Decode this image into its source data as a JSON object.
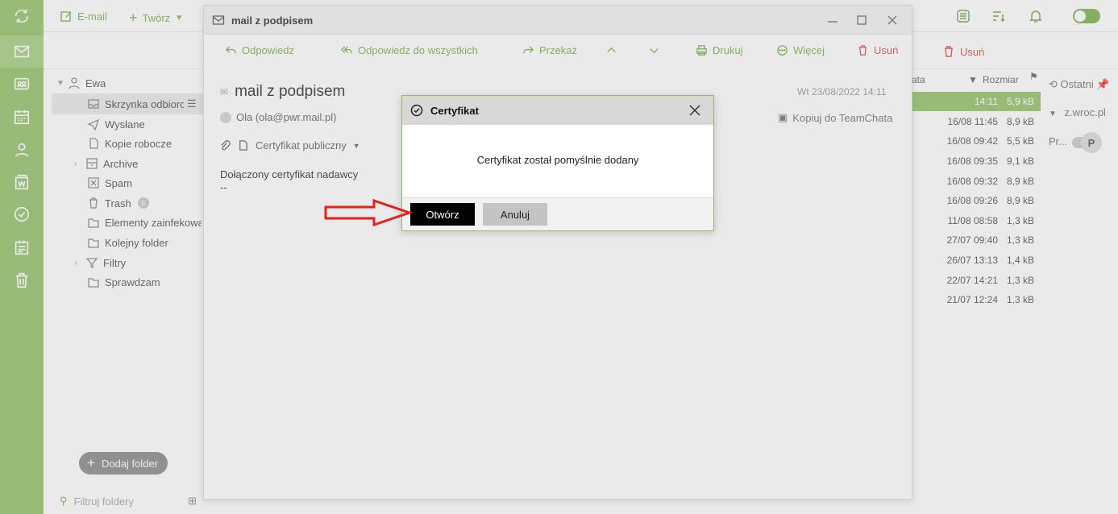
{
  "colors": {
    "accent": "#7db351",
    "rail": "#96c56e",
    "danger": "#d9534f",
    "dialog_border": "#8fbf66"
  },
  "rail": {
    "icons": [
      "sync-icon",
      "mail-icon",
      "contacts-chat-icon",
      "calendar-icon",
      "person-icon",
      "word-icon",
      "check-circle-icon",
      "tasks-icon",
      "trash-icon"
    ]
  },
  "topbar": {
    "email_label": "E-mail",
    "create_label": "Twórz"
  },
  "subbar": {
    "trash_label": "Usuń"
  },
  "folders": {
    "account": "Ewa",
    "items": [
      {
        "label": "Skrzynka odbiorcza",
        "icon": "inbox-icon"
      },
      {
        "label": "Wysłane",
        "icon": "send-icon"
      },
      {
        "label": "Kopie robocze",
        "icon": "draft-icon"
      },
      {
        "label": "Archive",
        "icon": "archive-icon"
      },
      {
        "label": "Spam",
        "icon": "spam-icon"
      },
      {
        "label": "Trash",
        "icon": "trash-icon",
        "badge": "6"
      },
      {
        "label": "Elementy zainfekowane",
        "icon": "folder-icon"
      },
      {
        "label": "Kolejny folder",
        "icon": "folder-icon"
      },
      {
        "label": "Filtry",
        "icon": "filter-icon"
      },
      {
        "label": "Sprawdzam",
        "icon": "folder-icon"
      }
    ],
    "add_folder": "Dodaj folder",
    "filter_placeholder": "Filtruj foldery"
  },
  "message_list": {
    "date_header": "ata",
    "size_header": "Rozmiar",
    "rows": [
      {
        "date": "14:11",
        "size": "5,9 kB"
      },
      {
        "date": "16/08 11:45",
        "size": "8,9 kB"
      },
      {
        "date": "16/08 09:42",
        "size": "5,5 kB"
      },
      {
        "date": "16/08 09:35",
        "size": "9,1 kB"
      },
      {
        "date": "16/08 09:32",
        "size": "8,9 kB"
      },
      {
        "date": "16/08 09:26",
        "size": "8,9 kB"
      },
      {
        "date": "11/08 08:58",
        "size": "1,3 kB"
      },
      {
        "date": "27/07 09:40",
        "size": "1,3 kB"
      },
      {
        "date": "26/07 13:13",
        "size": "1,4 kB"
      },
      {
        "date": "22/07 14:21",
        "size": "1,3 kB"
      },
      {
        "date": "21/07 12:24",
        "size": "1,3 kB"
      }
    ]
  },
  "right_panel": {
    "recent": "Ostatni",
    "domain": "z.wroc.pl",
    "pr": "Pr...",
    "avatar_letter": "P"
  },
  "mail_window": {
    "title": "mail z podpisem",
    "toolbar": {
      "reply": "Odpowiedz",
      "reply_all": "Odpowiedz do wszystkich",
      "forward": "Przekaż",
      "print": "Drukuj",
      "more": "Więcej",
      "delete": "Usuń"
    },
    "subject": "mail z podpisem",
    "date": "Wt 23/08/2022 14:11",
    "from": "Ola (ola@pwr.mail.pl)",
    "copy_to_teamchat": "Kopiuj do TeamChata",
    "attachment": "Certyfikat publiczny",
    "body_line1": "Dołączony certyfikat nadawcy",
    "body_line2": "--"
  },
  "dialog": {
    "title": "Certyfikat",
    "message": "Certyfikat został pomyślnie dodany",
    "open_button": "Otwórz",
    "cancel_button": "Anuluj"
  }
}
